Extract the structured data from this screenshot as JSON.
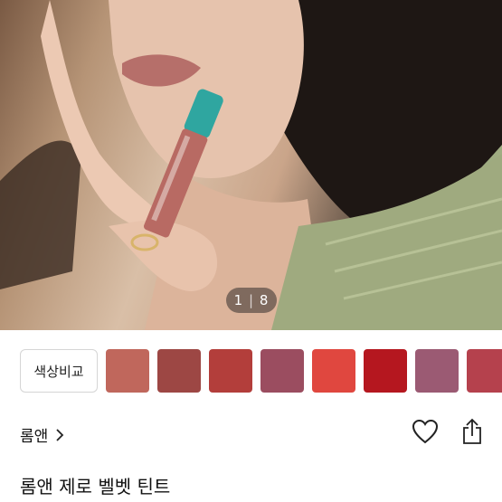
{
  "gallery": {
    "current": "1",
    "separator": "|",
    "total": "8"
  },
  "compare_button": {
    "label": "색상비교"
  },
  "swatches": [
    {
      "color": "#c0675c"
    },
    {
      "color": "#9d4744"
    },
    {
      "color": "#b33e3b"
    },
    {
      "color": "#9b4d60"
    },
    {
      "color": "#e0473f"
    },
    {
      "color": "#b5171f"
    },
    {
      "color": "#9b5a73"
    },
    {
      "color": "#b5414d"
    }
  ],
  "brand": {
    "name": "롬앤"
  },
  "product": {
    "title": "롬앤 제로 벨벳 틴트"
  },
  "icons": {
    "chevron": "chevron-right-icon",
    "like": "heart-icon",
    "share": "share-icon"
  }
}
